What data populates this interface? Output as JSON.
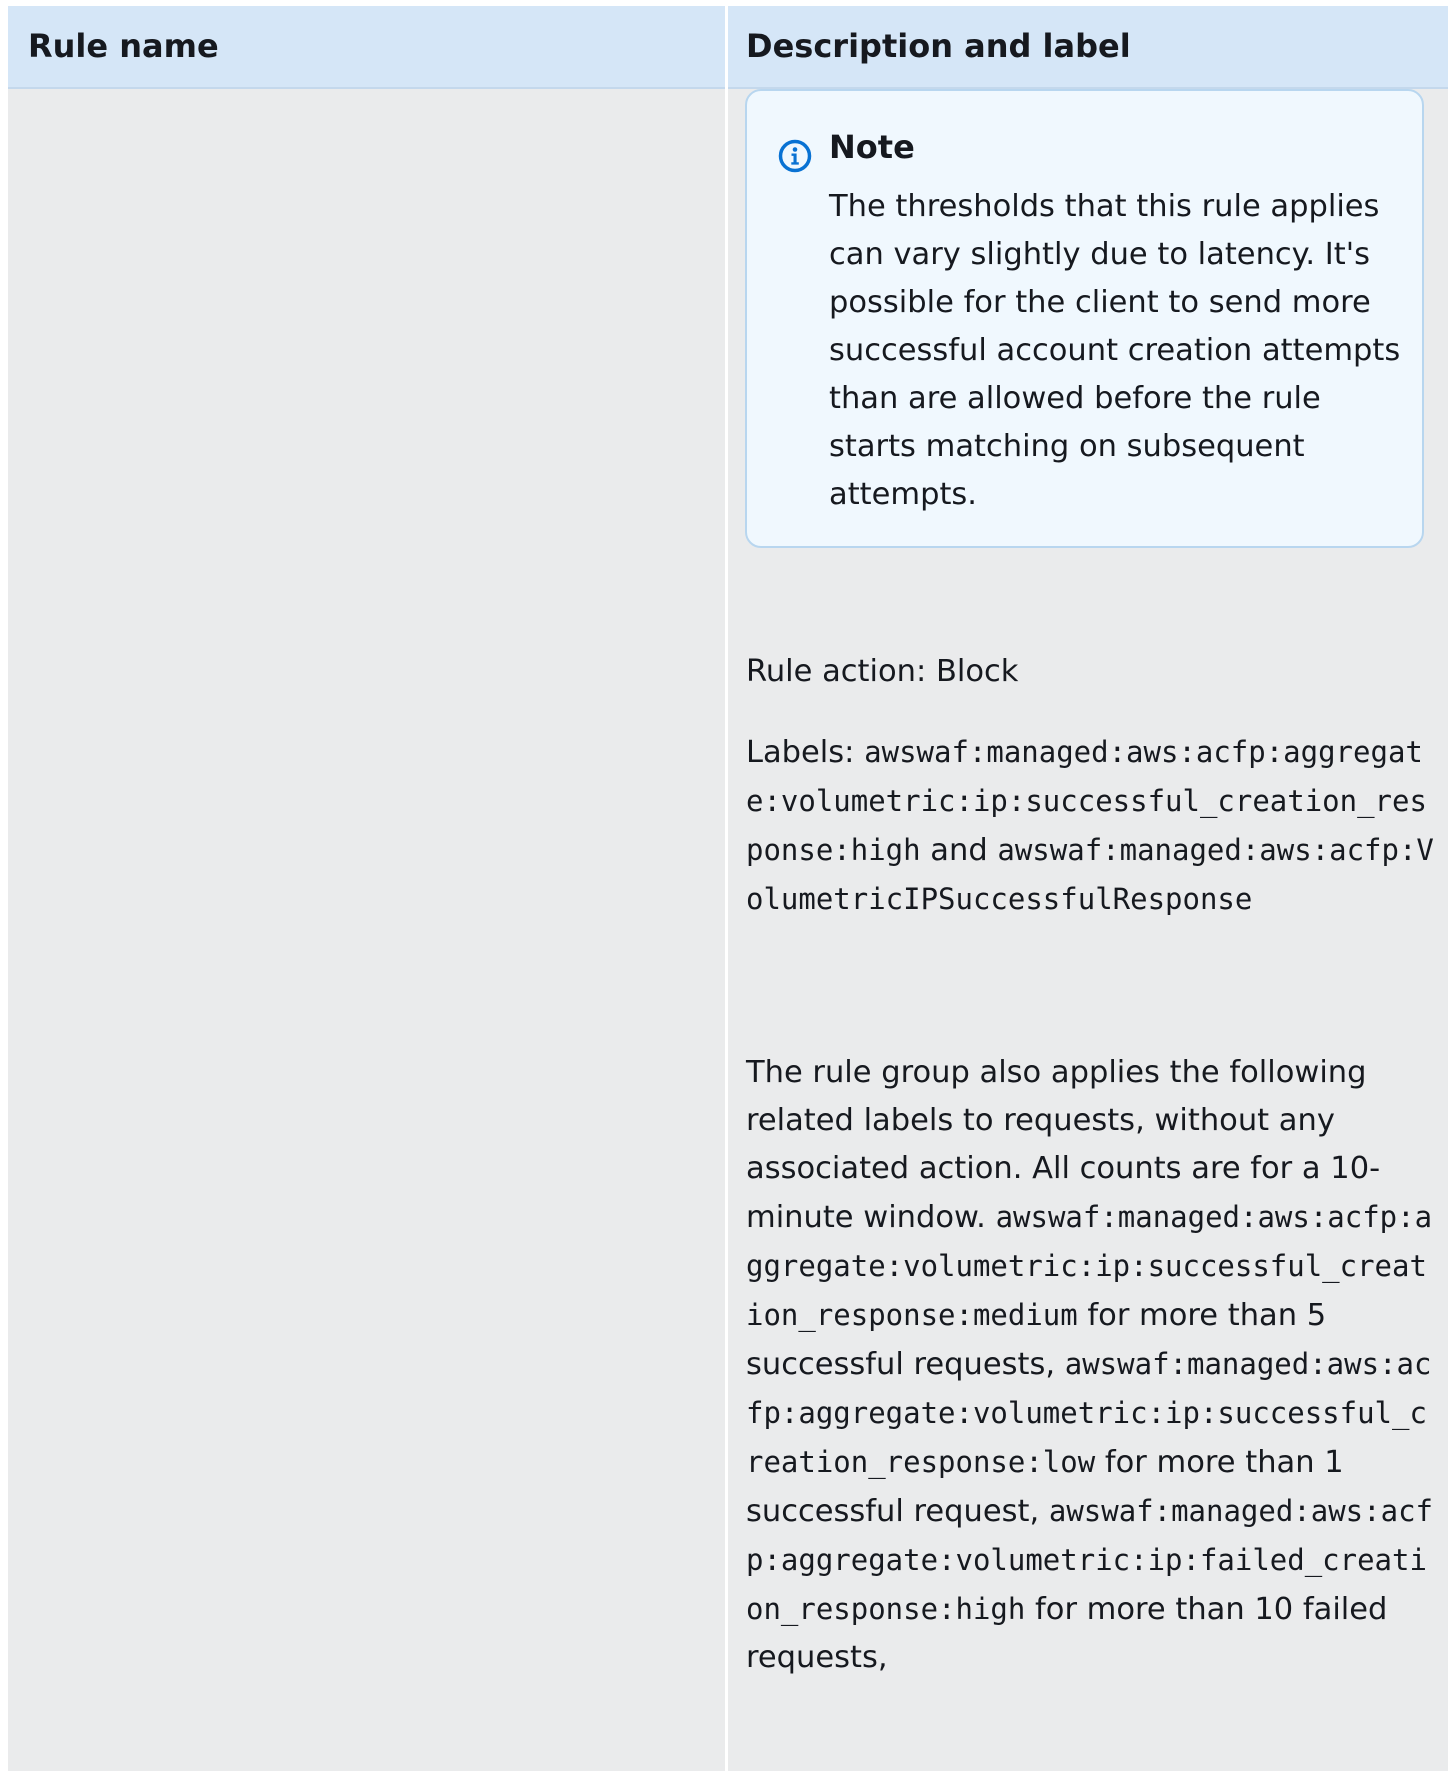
{
  "header": {
    "col1": "Rule name",
    "col2": "Description and label"
  },
  "note": {
    "icon": "info-icon",
    "title": "Note",
    "body": "The thresholds that this rule applies can vary slightly due to latency. It's  possible for the client to send more successful  account creation attempts than are allowed before   the rule starts matching on subsequent attempts."
  },
  "rule_action": "Rule action: Block",
  "labels": {
    "prefix": "Labels:  ",
    "label1": "awswaf:managed:aws:acfp:aggregate:volumetric:ip:successful_creation_response:high",
    "joiner": "  and ",
    "label2": "awswaf:managed:aws:acfp:VolumetricIPSuccessfulResponse"
  },
  "related": {
    "intro": "The rule group also applies the following related labels to  requests, without any associated action. All counts are for a 10-minute window.  ",
    "label_medium": "awswaf:managed:aws:acfp:aggregate:volumetric:ip:successful_creation_response:medium",
    "text_medium": "   for more than 5 successful requests, ",
    "label_low": "awswaf:managed:aws:acfp:aggregate:volumetric:ip:successful_creation_response:low",
    "text_low": "  for more than 1 successful request, ",
    "label_failed_high": "awswaf:managed:aws:acfp:aggregate:volumetric:ip:failed_creation_response:high",
    "text_failed_high": "  for more than 10 failed requests,"
  }
}
